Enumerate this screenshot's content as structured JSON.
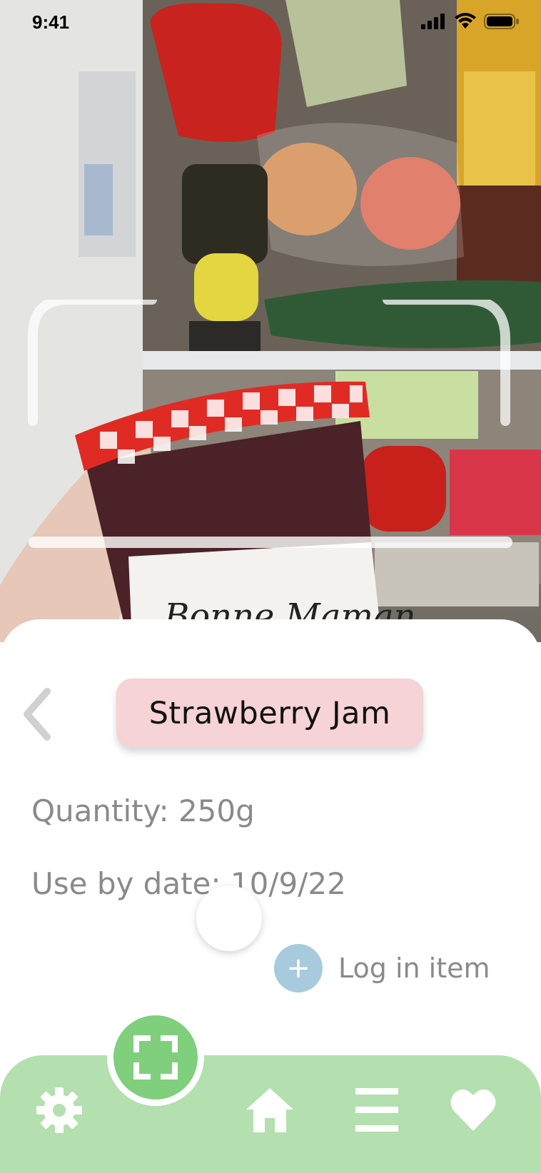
{
  "status_bar": {
    "time": "9:41"
  },
  "item": {
    "name": "Strawberry Jam",
    "quantity": "Quantity: 250g",
    "use_by": "Use by date: 10/9/22"
  },
  "actions": {
    "log_in_label": "Log in item",
    "log_in_icon": "+"
  },
  "nav": {
    "items": [
      "settings-icon",
      "scan-icon",
      "home-icon",
      "list-icon",
      "heart-icon"
    ]
  },
  "colors": {
    "title_pill": "#f5d3d6",
    "nav_bar": "#b3e0ae",
    "scan_button": "#7fcf7d",
    "log_button": "#a7cbdc",
    "muted_text": "#8a8a8a"
  }
}
